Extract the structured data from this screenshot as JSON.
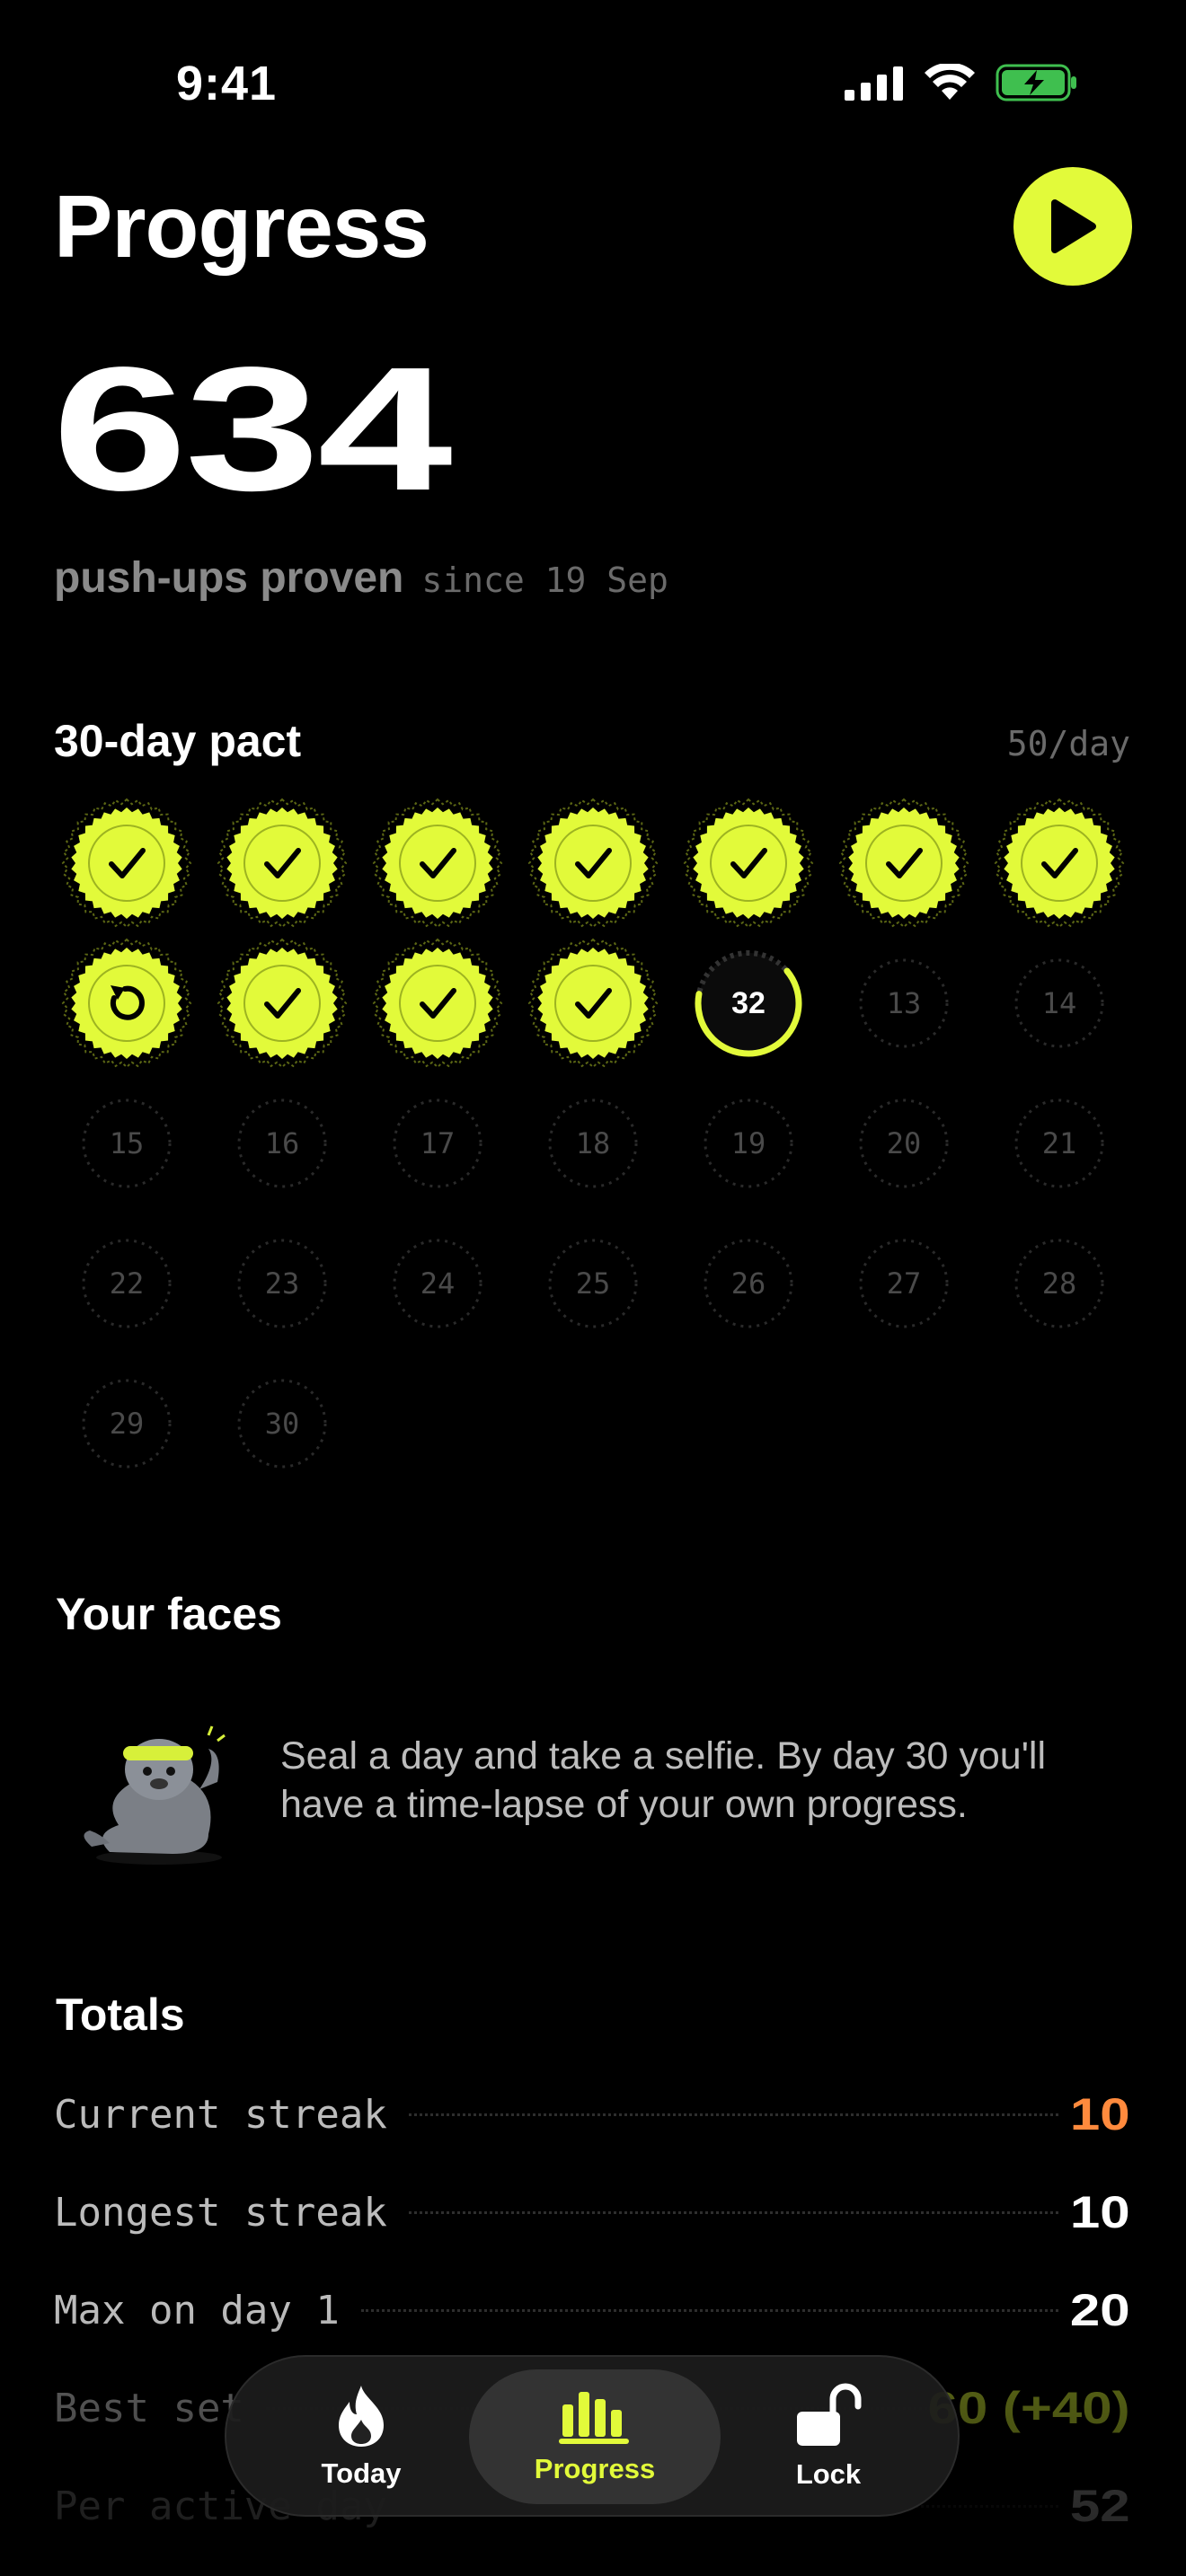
{
  "status_bar": {
    "time": "9:41"
  },
  "header": {
    "title": "Progress",
    "play_icon": "play-icon"
  },
  "summary": {
    "count": "634",
    "label": "push-ups proven",
    "since": "since 19 Sep"
  },
  "pact": {
    "title": "30-day pact",
    "per_day": "50/day",
    "days": [
      {
        "state": "sealed"
      },
      {
        "state": "sealed"
      },
      {
        "state": "sealed"
      },
      {
        "state": "sealed"
      },
      {
        "state": "sealed"
      },
      {
        "state": "sealed"
      },
      {
        "state": "sealed"
      },
      {
        "state": "retry"
      },
      {
        "state": "sealed"
      },
      {
        "state": "sealed"
      },
      {
        "state": "sealed"
      },
      {
        "state": "today",
        "label": "32",
        "progress": 0.64
      },
      {
        "state": "future",
        "label": "13"
      },
      {
        "state": "future",
        "label": "14"
      },
      {
        "state": "future",
        "label": "15"
      },
      {
        "state": "future",
        "label": "16"
      },
      {
        "state": "future",
        "label": "17"
      },
      {
        "state": "future",
        "label": "18"
      },
      {
        "state": "future",
        "label": "19"
      },
      {
        "state": "future",
        "label": "20"
      },
      {
        "state": "future",
        "label": "21"
      },
      {
        "state": "future",
        "label": "22"
      },
      {
        "state": "future",
        "label": "23"
      },
      {
        "state": "future",
        "label": "24"
      },
      {
        "state": "future",
        "label": "25"
      },
      {
        "state": "future",
        "label": "26"
      },
      {
        "state": "future",
        "label": "27"
      },
      {
        "state": "future",
        "label": "28"
      },
      {
        "state": "future",
        "label": "29"
      },
      {
        "state": "future",
        "label": "30"
      }
    ]
  },
  "faces": {
    "title": "Your faces",
    "text": "Seal a day and take a selfie. By day 30 you'll have a time-lapse of your own progress."
  },
  "totals": {
    "title": "Totals",
    "rows": [
      {
        "key": "Current streak",
        "value": "10"
      },
      {
        "key": "Longest streak",
        "value": "10"
      },
      {
        "key": "Max on day 1",
        "value": "20"
      },
      {
        "key": "Best set",
        "value": "60 (+40)"
      },
      {
        "key": "Per active day",
        "value": "52"
      }
    ]
  },
  "tabbar": {
    "tabs": [
      {
        "label": "Today",
        "icon": "flame-icon"
      },
      {
        "label": "Progress",
        "icon": "bar-chart-icon",
        "active": true
      },
      {
        "label": "Lock",
        "icon": "unlock-icon"
      }
    ]
  },
  "colors": {
    "accent": "#E2FA3A",
    "streak": "#FF8A3D"
  }
}
